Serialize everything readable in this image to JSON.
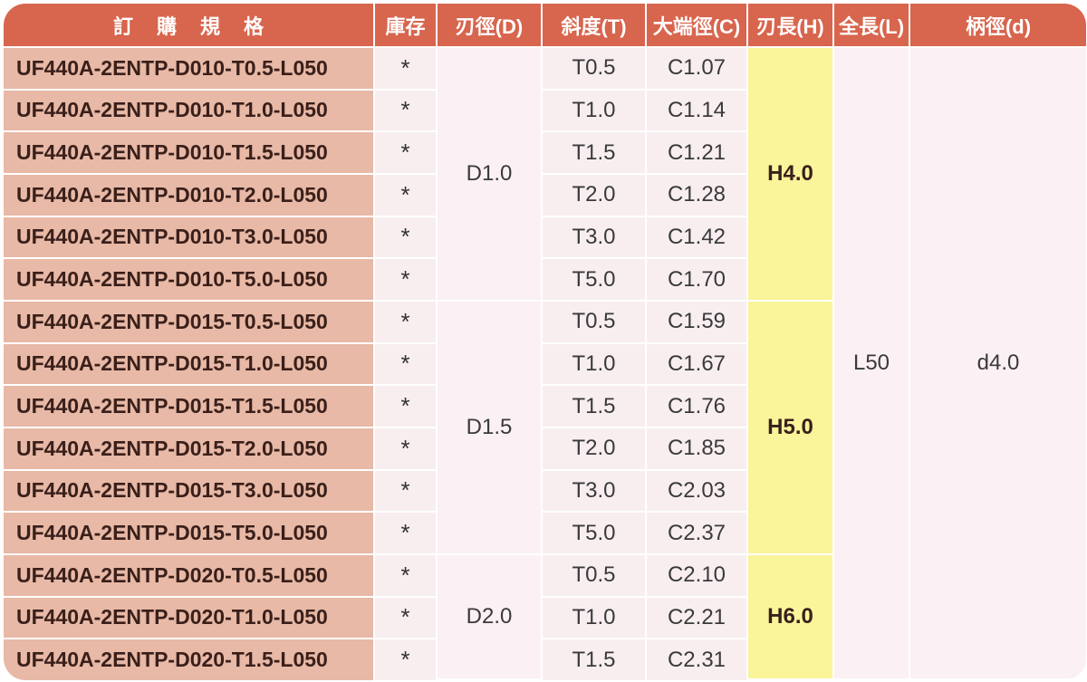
{
  "headers": {
    "order_spec": "訂購規格",
    "stock": "庫存",
    "blade_dia": "刃徑(D)",
    "taper": "斜度(T)",
    "large_end_dia": "大端徑(C)",
    "edge_length": "刃長(H)",
    "overall_length": "全長(L)",
    "shank_dia": "柄徑(d)"
  },
  "rows": [
    {
      "code": "UF440A-2ENTP-D010-T0.5-L050",
      "stock": "*",
      "taper": "T0.5",
      "large_end_dia": "C1.07"
    },
    {
      "code": "UF440A-2ENTP-D010-T1.0-L050",
      "stock": "*",
      "taper": "T1.0",
      "large_end_dia": "C1.14"
    },
    {
      "code": "UF440A-2ENTP-D010-T1.5-L050",
      "stock": "*",
      "taper": "T1.5",
      "large_end_dia": "C1.21"
    },
    {
      "code": "UF440A-2ENTP-D010-T2.0-L050",
      "stock": "*",
      "taper": "T2.0",
      "large_end_dia": "C1.28"
    },
    {
      "code": "UF440A-2ENTP-D010-T3.0-L050",
      "stock": "*",
      "taper": "T3.0",
      "large_end_dia": "C1.42"
    },
    {
      "code": "UF440A-2ENTP-D010-T5.0-L050",
      "stock": "*",
      "taper": "T5.0",
      "large_end_dia": "C1.70"
    },
    {
      "code": "UF440A-2ENTP-D015-T0.5-L050",
      "stock": "*",
      "taper": "T0.5",
      "large_end_dia": "C1.59"
    },
    {
      "code": "UF440A-2ENTP-D015-T1.0-L050",
      "stock": "*",
      "taper": "T1.0",
      "large_end_dia": "C1.67"
    },
    {
      "code": "UF440A-2ENTP-D015-T1.5-L050",
      "stock": "*",
      "taper": "T1.5",
      "large_end_dia": "C1.76"
    },
    {
      "code": "UF440A-2ENTP-D015-T2.0-L050",
      "stock": "*",
      "taper": "T2.0",
      "large_end_dia": "C1.85"
    },
    {
      "code": "UF440A-2ENTP-D015-T3.0-L050",
      "stock": "*",
      "taper": "T3.0",
      "large_end_dia": "C2.03"
    },
    {
      "code": "UF440A-2ENTP-D015-T5.0-L050",
      "stock": "*",
      "taper": "T5.0",
      "large_end_dia": "C2.37"
    },
    {
      "code": "UF440A-2ENTP-D020-T0.5-L050",
      "stock": "*",
      "taper": "T0.5",
      "large_end_dia": "C2.10"
    },
    {
      "code": "UF440A-2ENTP-D020-T1.0-L050",
      "stock": "*",
      "taper": "T1.0",
      "large_end_dia": "C2.21"
    },
    {
      "code": "UF440A-2ENTP-D020-T1.5-L050",
      "stock": "*",
      "taper": "T1.5",
      "large_end_dia": "C2.31"
    }
  ],
  "groups": [
    {
      "blade_dia": "D1.0",
      "edge_length": "H4.0"
    },
    {
      "blade_dia": "D1.5",
      "edge_length": "H5.0"
    },
    {
      "blade_dia": "D2.0",
      "edge_length": "H6.0"
    }
  ],
  "overall_length": "L50",
  "shank_dia": "d4.0",
  "colors": {
    "header_bg": "#d8654d",
    "code_bg": "#e7b9a6",
    "edge_highlight": "#faf49b",
    "cell_bg": "#fbf0f4"
  }
}
